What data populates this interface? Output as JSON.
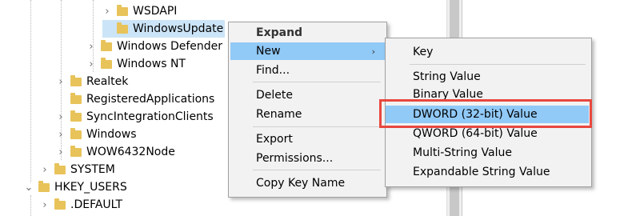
{
  "tree": {
    "nodes": [
      {
        "label": "WSDAPI",
        "expander": "›"
      },
      {
        "label": "WindowsUpdate",
        "expander": ""
      },
      {
        "label": "Windows Defender",
        "expander": "›"
      },
      {
        "label": "Windows NT",
        "expander": "›"
      },
      {
        "label": "Realtek",
        "expander": "›"
      },
      {
        "label": "RegisteredApplications",
        "expander": ""
      },
      {
        "label": "SyncIntegrationClients",
        "expander": "›"
      },
      {
        "label": "Windows",
        "expander": "›"
      },
      {
        "label": "WOW6432Node",
        "expander": "›"
      },
      {
        "label": "SYSTEM",
        "expander": "›"
      },
      {
        "label": "HKEY_USERS",
        "expander": "⌄"
      },
      {
        "label": ".DEFAULT",
        "expander": "›"
      }
    ]
  },
  "context_menu": {
    "items": [
      {
        "label": "Expand"
      },
      {
        "label": "New",
        "submenu_arrow": "›"
      },
      {
        "label": "Find..."
      },
      {
        "label": "Delete"
      },
      {
        "label": "Rename"
      },
      {
        "label": "Export"
      },
      {
        "label": "Permissions..."
      },
      {
        "label": "Copy Key Name"
      }
    ]
  },
  "submenu": {
    "items": [
      {
        "label": "Key"
      },
      {
        "label": "String Value"
      },
      {
        "label": "Binary Value"
      },
      {
        "label": "DWORD (32-bit) Value"
      },
      {
        "label": "QWORD (64-bit) Value"
      },
      {
        "label": "Multi-String Value"
      },
      {
        "label": "Expandable String Value"
      }
    ]
  },
  "colors": {
    "highlight_border": "#e8483f",
    "menu_hover": "#91c9f7",
    "tree_selection": "#cce4f7",
    "folder": "#e8c35a"
  }
}
